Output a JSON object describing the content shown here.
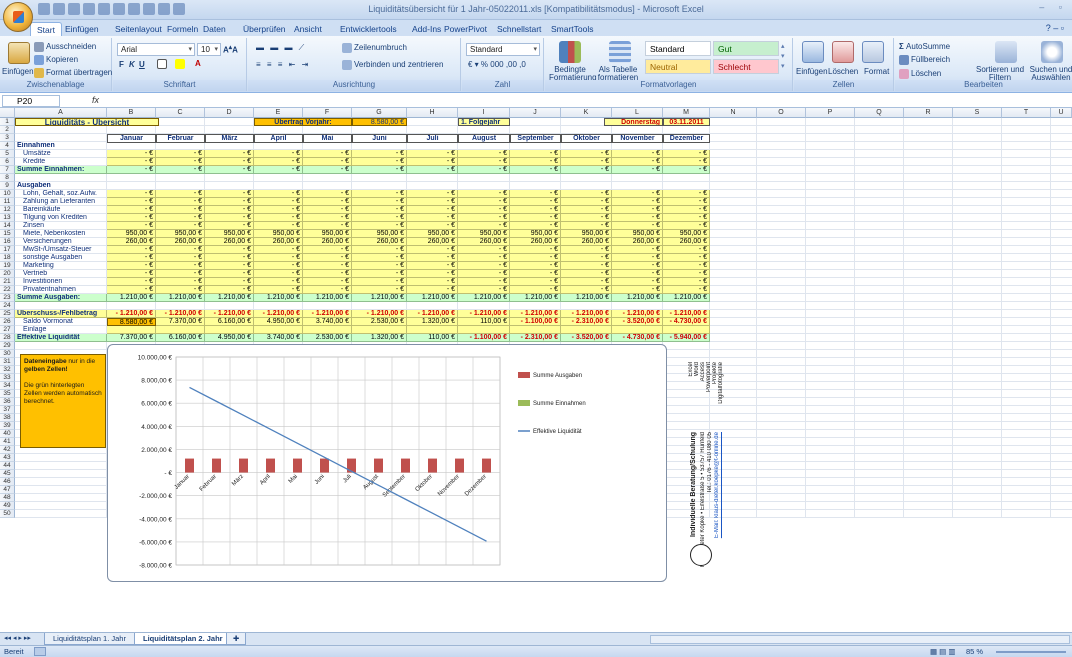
{
  "window": {
    "title": "Liquiditätsübersicht für 1 Jahr-05022011.xls [Kompatibilitätsmodus] - Microsoft Excel"
  },
  "tabs": [
    "Start",
    "Einfügen",
    "Seitenlayout",
    "Formeln",
    "Daten",
    "Überprüfen",
    "Ansicht",
    "Entwicklertools",
    "Add-Ins",
    "PowerPivot",
    "Schnellstart",
    "SmartTools"
  ],
  "ribbon": {
    "clipboard": {
      "label": "Zwischenablage",
      "paste": "Einfügen",
      "cut": "Ausschneiden",
      "copy": "Kopieren",
      "format_painter": "Format übertragen"
    },
    "font": {
      "label": "Schriftart",
      "font_name": "Arial",
      "font_size": "10"
    },
    "alignment": {
      "label": "Ausrichtung",
      "wrap": "Zeilenumbruch",
      "merge": "Verbinden und zentrieren"
    },
    "number": {
      "label": "Zahl",
      "format": "Standard"
    },
    "styles": {
      "label": "Formatvorlagen",
      "conditional": "Bedingte Formatierung",
      "as_table": "Als Tabelle formatieren",
      "standard": "Standard",
      "gut": "Gut",
      "neutral": "Neutral",
      "schlecht": "Schlecht"
    },
    "cells": {
      "label": "Zellen",
      "insert": "Einfügen",
      "delete": "Löschen",
      "format": "Format"
    },
    "editing": {
      "label": "Bearbeiten",
      "autosum": "AutoSumme",
      "fill": "Füllbereich",
      "clear": "Löschen",
      "sort": "Sortieren und Filtern",
      "find": "Suchen und Auswählen"
    }
  },
  "formula_bar": {
    "name_box": "P20",
    "fx": "fx",
    "content": ""
  },
  "columns": [
    "A",
    "B",
    "C",
    "D",
    "E",
    "F",
    "G",
    "H",
    "I",
    "J",
    "K",
    "L",
    "M",
    "N",
    "O",
    "P",
    "Q",
    "R",
    "S",
    "T",
    "U"
  ],
  "sheet": {
    "title": "Liquiditäts - Übersicht",
    "carryover_label": "Übertrag Vorjahr:",
    "carryover_value": "8.580,00 €",
    "year_label": "1. Folgejahr",
    "weekday": "Donnerstag",
    "date": "03.11.2011",
    "months": [
      "Januar",
      "Februar",
      "März",
      "April",
      "Mai",
      "Juni",
      "Juli",
      "August",
      "September",
      "Oktober",
      "November",
      "Dezember"
    ],
    "sections": {
      "income": "Einnahmen",
      "expenses": "Ausgaben"
    },
    "rows": [
      {
        "r": 5,
        "label": "Umsätze",
        "type": "yel",
        "values": [
          "-   €",
          "-   €",
          "-   €",
          "-   €",
          "-   €",
          "-   €",
          "-   €",
          "-   €",
          "-   €",
          "-   €",
          "-   €",
          "-   €"
        ]
      },
      {
        "r": 6,
        "label": "Kredite",
        "type": "yel",
        "values": [
          "-   €",
          "-   €",
          "-   €",
          "-   €",
          "-   €",
          "-   €",
          "-   €",
          "-   €",
          "-   €",
          "-   €",
          "-   €",
          "-   €"
        ]
      },
      {
        "r": 7,
        "label": "Summe Einnahmen:",
        "type": "grn",
        "bold": true,
        "values": [
          "-   €",
          "-   €",
          "-   €",
          "-   €",
          "-   €",
          "-   €",
          "-   €",
          "-   €",
          "-   €",
          "-   €",
          "-   €",
          "-   €"
        ]
      },
      {
        "r": 10,
        "label": "Lohn, Gehalt, soz.Aufw.",
        "type": "yel",
        "values": [
          "-   €",
          "-   €",
          "-   €",
          "-   €",
          "-   €",
          "-   €",
          "-   €",
          "-   €",
          "-   €",
          "-   €",
          "-   €",
          "-   €"
        ]
      },
      {
        "r": 11,
        "label": "Zahlung an Lieferanten",
        "type": "yel",
        "values": [
          "-   €",
          "-   €",
          "-   €",
          "-   €",
          "-   €",
          "-   €",
          "-   €",
          "-   €",
          "-   €",
          "-   €",
          "-   €",
          "-   €"
        ]
      },
      {
        "r": 12,
        "label": "Bareinkäufe",
        "type": "yel",
        "values": [
          "-   €",
          "-   €",
          "-   €",
          "-   €",
          "-   €",
          "-   €",
          "-   €",
          "-   €",
          "-   €",
          "-   €",
          "-   €",
          "-   €"
        ]
      },
      {
        "r": 13,
        "label": "Tilgung von Krediten",
        "type": "yel",
        "values": [
          "-   €",
          "-   €",
          "-   €",
          "-   €",
          "-   €",
          "-   €",
          "-   €",
          "-   €",
          "-   €",
          "-   €",
          "-   €",
          "-   €"
        ]
      },
      {
        "r": 14,
        "label": "Zinsen",
        "type": "yel",
        "values": [
          "-   €",
          "-   €",
          "-   €",
          "-   €",
          "-   €",
          "-   €",
          "-   €",
          "-   €",
          "-   €",
          "-   €",
          "-   €",
          "-   €"
        ]
      },
      {
        "r": 15,
        "label": "Miete, Nebenkosten",
        "type": "yel",
        "values": [
          "950,00 €",
          "950,00 €",
          "950,00 €",
          "950,00 €",
          "950,00 €",
          "950,00 €",
          "950,00 €",
          "950,00 €",
          "950,00 €",
          "950,00 €",
          "950,00 €",
          "950,00 €"
        ]
      },
      {
        "r": 16,
        "label": "Versicherungen",
        "type": "yel",
        "values": [
          "260,00 €",
          "260,00 €",
          "260,00 €",
          "260,00 €",
          "260,00 €",
          "260,00 €",
          "260,00 €",
          "260,00 €",
          "260,00 €",
          "260,00 €",
          "260,00 €",
          "260,00 €"
        ]
      },
      {
        "r": 17,
        "label": "MwSt-/Umsatz-Steuer",
        "type": "yel",
        "values": [
          "-   €",
          "-   €",
          "-   €",
          "-   €",
          "-   €",
          "-   €",
          "-   €",
          "-   €",
          "-   €",
          "-   €",
          "-   €",
          "-   €"
        ]
      },
      {
        "r": 18,
        "label": "sonstige Ausgaben",
        "type": "yel",
        "values": [
          "-   €",
          "-   €",
          "-   €",
          "-   €",
          "-   €",
          "-   €",
          "-   €",
          "-   €",
          "-   €",
          "-   €",
          "-   €",
          "-   €"
        ]
      },
      {
        "r": 19,
        "label": "Marketing",
        "type": "yel",
        "values": [
          "-   €",
          "-   €",
          "-   €",
          "-   €",
          "-   €",
          "-   €",
          "-   €",
          "-   €",
          "-   €",
          "-   €",
          "-   €",
          "-   €"
        ]
      },
      {
        "r": 20,
        "label": "Vertrieb",
        "type": "yel",
        "values": [
          "-   €",
          "-   €",
          "-   €",
          "-   €",
          "-   €",
          "-   €",
          "-   €",
          "-   €",
          "-   €",
          "-   €",
          "-   €",
          "-   €"
        ]
      },
      {
        "r": 21,
        "label": "Investitionen",
        "type": "yel",
        "values": [
          "-   €",
          "-   €",
          "-   €",
          "-   €",
          "-   €",
          "-   €",
          "-   €",
          "-   €",
          "-   €",
          "-   €",
          "-   €",
          "-   €"
        ]
      },
      {
        "r": 22,
        "label": "Privatentnahmen",
        "type": "yel",
        "values": [
          "-   €",
          "-   €",
          "-   €",
          "-   €",
          "-   €",
          "-   €",
          "-   €",
          "-   €",
          "-   €",
          "-   €",
          "-   €",
          "-   €"
        ]
      },
      {
        "r": 23,
        "label": "Summe Ausgaben:",
        "type": "grn",
        "bold": true,
        "values": [
          "1.210,00 €",
          "1.210,00 €",
          "1.210,00 €",
          "1.210,00 €",
          "1.210,00 €",
          "1.210,00 €",
          "1.210,00 €",
          "1.210,00 €",
          "1.210,00 €",
          "1.210,00 €",
          "1.210,00 €",
          "1.210,00 €"
        ]
      },
      {
        "r": 25,
        "label": "Überschuss-/Fehlbetrag",
        "type": "yelred",
        "bold": true,
        "values": [
          "-  1.210,00 €",
          "-  1.210,00 €",
          "-  1.210,00 €",
          "-  1.210,00 €",
          "-  1.210,00 €",
          "-  1.210,00 €",
          "-  1.210,00 €",
          "-  1.210,00 €",
          "-  1.210,00 €",
          "-  1.210,00 €",
          "-  1.210,00 €",
          "-  1.210,00 €"
        ]
      },
      {
        "r": 26,
        "label": "Saldo Vormonat",
        "type": "saldo",
        "values": [
          "8.580,00 €",
          "7.370,00 €",
          "6.160,00 €",
          "4.950,00 €",
          "3.740,00 €",
          "2.530,00 €",
          "1.320,00 €",
          "110,00 €",
          "-  1.100,00 €",
          "-  2.310,00 €",
          "-  3.520,00 €",
          "-  4.730,00 €"
        ]
      },
      {
        "r": 27,
        "label": "Einlage",
        "type": "yel",
        "values": [
          "",
          "",
          "",
          "",
          "",
          "",
          "",
          "",
          "",
          "",
          "",
          ""
        ]
      },
      {
        "r": 28,
        "label": "Effektive Liquidität",
        "type": "grnliq",
        "bold": true,
        "values": [
          "7.370,00 €",
          "6.160,00 €",
          "4.950,00 €",
          "3.740,00 €",
          "2.530,00 €",
          "1.320,00 €",
          "110,00 €",
          "-  1.100,00 €",
          "-  2.310,00 €",
          "-  3.520,00 €",
          "-  4.730,00 €",
          "-  5.940,00 €"
        ]
      }
    ],
    "note": {
      "line1_bold": "Dateneingabe",
      "line1_rest": " nur in die",
      "line2_bold": "gelben Zellen!",
      "line3": "Die grün hinterlegten Zellen werden automatisch berechnet."
    },
    "side_text": {
      "heading": "Individuelle Beratung/Schulung",
      "address": "Klaus-Dieter Köpke • Eifelstraße 5 • 53757 Hünfeld",
      "phone": "Tel.: 0176 - 410 080 05",
      "email": "E-Mail: klaus-dieter.koepke@t-online.de",
      "services": [
        "Excel",
        "Word",
        "Access",
        "Powerpoint",
        "Projekte",
        "Digitalfotografie"
      ]
    }
  },
  "chart_data": {
    "type": "bar",
    "categories": [
      "Januar",
      "Februar",
      "März",
      "April",
      "Mai",
      "Juni",
      "Juli",
      "August",
      "September",
      "Oktober",
      "November",
      "Dezember"
    ],
    "series": [
      {
        "name": "Summe Ausgaben",
        "kind": "bar",
        "color": "#c0504d",
        "values": [
          1210,
          1210,
          1210,
          1210,
          1210,
          1210,
          1210,
          1210,
          1210,
          1210,
          1210,
          1210
        ]
      },
      {
        "name": "Summe Einnahmen",
        "kind": "bar",
        "color": "#9bbb59",
        "values": [
          0,
          0,
          0,
          0,
          0,
          0,
          0,
          0,
          0,
          0,
          0,
          0
        ]
      },
      {
        "name": "Effektive Liquidität",
        "kind": "line",
        "color": "#4f81bd",
        "values": [
          7370,
          6160,
          4950,
          3740,
          2530,
          1320,
          110,
          -1100,
          -2310,
          -3520,
          -4730,
          -5940
        ]
      }
    ],
    "ylim": [
      -8000,
      10000
    ],
    "yticks": [
      "10.000,00 €",
      "8.000,00 €",
      "6.000,00 €",
      "4.000,00 €",
      "2.000,00 €",
      "-   €",
      "-2.000,00 €",
      "-4.000,00 €",
      "-6.000,00 €",
      "-8.000,00 €"
    ],
    "ytick_values": [
      10000,
      8000,
      6000,
      4000,
      2000,
      0,
      -2000,
      -4000,
      -6000,
      -8000
    ],
    "grid": true,
    "legend": "right"
  },
  "sheet_tabs": [
    "Liquiditätsplan 1. Jahr",
    "Liquiditätsplan 2. Jahr"
  ],
  "status": {
    "ready": "Bereit",
    "zoom": "85 %"
  },
  "colors": {
    "yellow": "#ffff99",
    "green": "#ccffcc",
    "orange": "#ffc000",
    "red": "#d00000",
    "ribbon_blue": "#15428b"
  }
}
